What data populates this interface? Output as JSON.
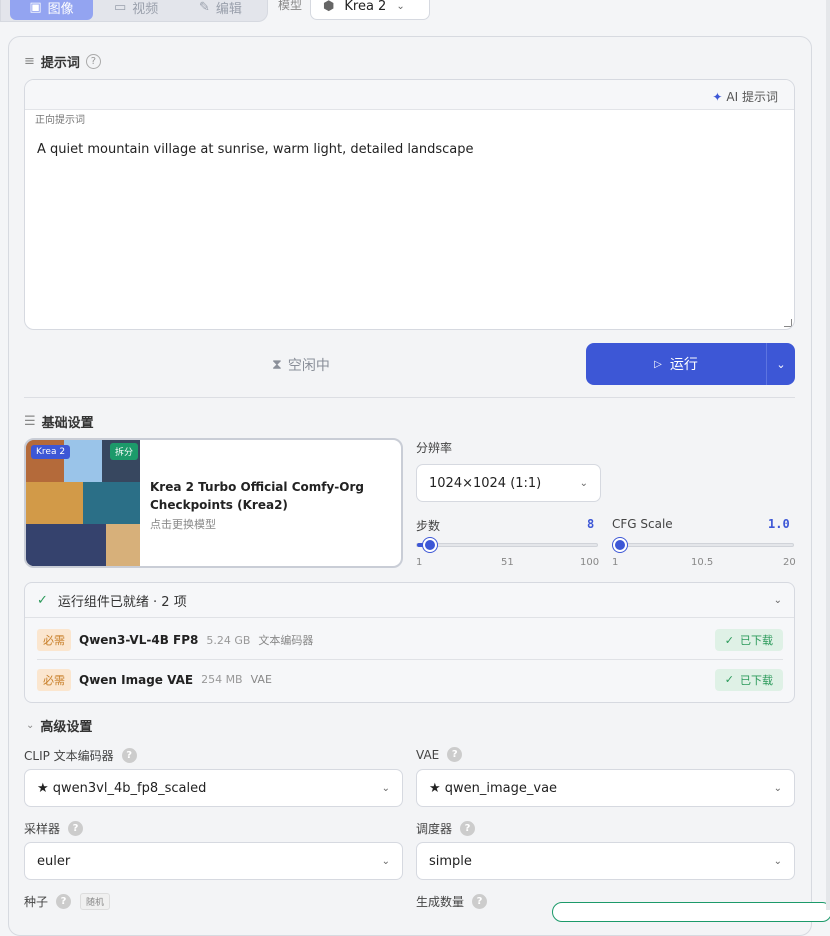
{
  "tabs": [
    {
      "label": "图像",
      "icon": "image-icon"
    },
    {
      "label": "视频",
      "icon": "video-icon"
    },
    {
      "label": "编辑",
      "icon": "edit-icon"
    }
  ],
  "model_selector": {
    "label": "模型",
    "value": "Krea 2"
  },
  "prompt": {
    "section_title": "提示词",
    "ai_button": "AI 提示词",
    "positive_label": "正向提示词",
    "text": "A quiet mountain village at sunrise, warm light, detailed landscape"
  },
  "status": {
    "idle": "空闲中"
  },
  "run": {
    "label": "运行"
  },
  "basic": {
    "section_title": "基础设置",
    "model_card": {
      "badge": "Krea 2",
      "split_badge": "拆分",
      "title": "Krea 2 Turbo Official Comfy-Org Checkpoints (Krea2)",
      "subtitle": "点击更换模型"
    },
    "resolution": {
      "label": "分辨率",
      "value": "1024×1024 (1:1)"
    },
    "steps": {
      "label": "步数",
      "value": "8",
      "min": "1",
      "mid": "51",
      "max": "100",
      "fraction": 0.07
    },
    "cfg": {
      "label": "CFG Scale",
      "value": "1.0",
      "min": "1",
      "mid": "10.5",
      "max": "20",
      "fraction": 0.0
    }
  },
  "deps": {
    "header": "运行组件已就绪 · 2 项",
    "items": [
      {
        "tag": "必需",
        "name": "Qwen3-VL-4B FP8",
        "size": "5.24 GB",
        "type": "文本编码器",
        "status": "已下载"
      },
      {
        "tag": "必需",
        "name": "Qwen Image VAE",
        "size": "254 MB",
        "type": "VAE",
        "status": "已下载"
      }
    ]
  },
  "advanced": {
    "section_title": "高级设置",
    "clip": {
      "label": "CLIP 文本编码器",
      "value": "★ qwen3vl_4b_fp8_scaled"
    },
    "vae": {
      "label": "VAE",
      "value": "★ qwen_image_vae"
    },
    "sampler": {
      "label": "采样器",
      "value": "euler"
    },
    "scheduler": {
      "label": "调度器",
      "value": "simple"
    },
    "seed": {
      "label": "种子",
      "random": "随机"
    },
    "count": {
      "label": "生成数量"
    }
  },
  "colors": {
    "accent": "#3d57d6",
    "success": "#2b9a5a",
    "warning": "#c77d26"
  }
}
